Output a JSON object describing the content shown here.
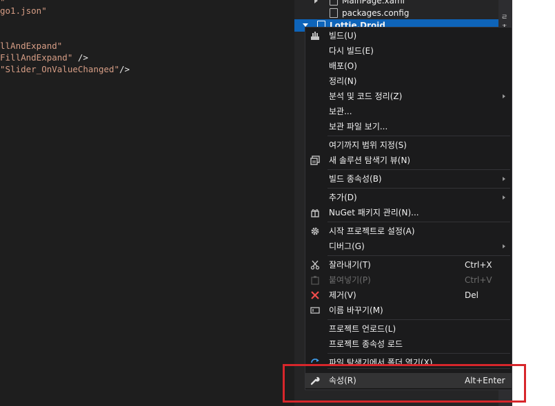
{
  "editor": {
    "lines": [
      {
        "pre": "",
        "str": "\"",
        "post": ""
      },
      {
        "pre": "",
        "str": "go1.json\"",
        "post": ""
      },
      {
        "pre": "",
        "str": "",
        "post": ""
      },
      {
        "pre": "",
        "str": "",
        "post": ""
      },
      {
        "pre": "",
        "str": "llAndExpand\"",
        "post": ""
      },
      {
        "pre": "",
        "str": "FillAndExpand\"",
        "post": " />"
      },
      {
        "pre": "",
        "str": "\"Slider_OnValueChanged\"",
        "post": "/>"
      }
    ]
  },
  "solution_explorer": {
    "items": [
      {
        "label": "MainPage.xaml"
      },
      {
        "label": "packages.config"
      },
      {
        "label": "Lottie.Droid"
      }
    ]
  },
  "context_menu": {
    "items": [
      {
        "id": "build",
        "label": "빌드(U)",
        "icon": "build-icon"
      },
      {
        "id": "rebuild",
        "label": "다시 빌드(E)"
      },
      {
        "id": "deploy",
        "label": "배포(O)"
      },
      {
        "id": "clean",
        "label": "정리(N)"
      },
      {
        "id": "analyze",
        "label": "분석 및 코드 정리(Z)",
        "submenu": true
      },
      {
        "id": "archive",
        "label": "보관..."
      },
      {
        "id": "view-archive",
        "label": "보관 파일 보기..."
      },
      {
        "id": "scope-to-this",
        "label": "여기까지 범위 지정(S)"
      },
      {
        "id": "new-view",
        "label": "새 솔루션 탐색기 뷰(N)",
        "icon": "new-window-icon"
      },
      {
        "id": "build-deps",
        "label": "빌드 종속성(B)",
        "submenu": true
      },
      {
        "id": "add",
        "label": "추가(D)",
        "submenu": true
      },
      {
        "id": "nuget",
        "label": "NuGet 패키지 관리(N)...",
        "icon": "nuget-icon"
      },
      {
        "id": "set-startup",
        "label": "시작 프로젝트로 설정(A)",
        "icon": "gear-icon"
      },
      {
        "id": "debug",
        "label": "디버그(G)",
        "submenu": true
      },
      {
        "id": "cut",
        "label": "잘라내기(T)",
        "shortcut": "Ctrl+X",
        "icon": "scissors-icon"
      },
      {
        "id": "paste",
        "label": "붙여넣기(P)",
        "shortcut": "Ctrl+V",
        "icon": "clipboard-icon",
        "disabled": true
      },
      {
        "id": "remove",
        "label": "제거(V)",
        "shortcut": "Del",
        "icon": "remove-x-icon"
      },
      {
        "id": "rename",
        "label": "이름 바꾸기(M)",
        "icon": "rename-icon"
      },
      {
        "id": "unload",
        "label": "프로젝트 언로드(L)"
      },
      {
        "id": "load-deps",
        "label": "프로젝트 종속성 로드"
      },
      {
        "id": "open-folder",
        "label": "파일 탐색기에서 폴더 열기(X)",
        "icon": "refresh-icon"
      },
      {
        "id": "properties",
        "label": "속성(R)",
        "shortcut": "Alt+Enter",
        "icon": "wrench-icon"
      }
    ]
  },
  "colors": {
    "highlight_box": "#d7262b",
    "selection": "#0e64b9",
    "menu_bg": "#1b1b1c"
  }
}
